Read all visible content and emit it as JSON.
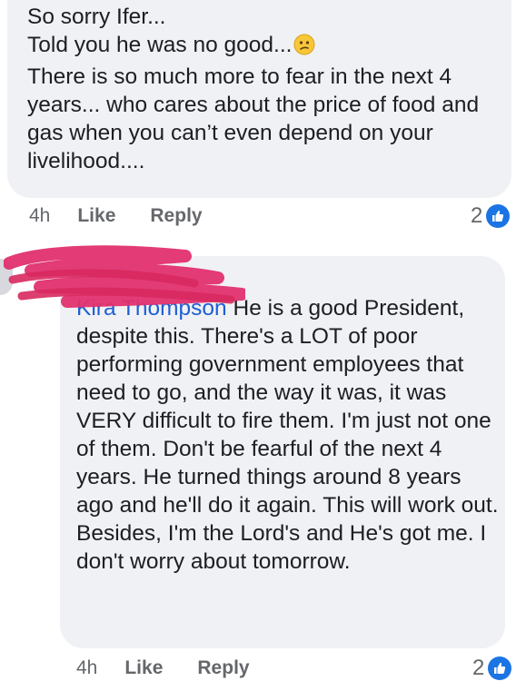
{
  "comment1": {
    "text_before_emoji": "So sorry Ifer...\nTold you he was no good...",
    "text_after_emoji": "\nThere is so much more to fear in the next 4 years... who cares about the price of food and gas when you can’t even depend on your livelihood....",
    "emoji": "confused-face-icon",
    "time": "4h",
    "like_label": "Like",
    "reply_label": "Reply",
    "reaction_count": "2"
  },
  "comment2": {
    "mention": "Kira Thompson",
    "text": " He is a good President, despite this. There's a LOT of poor performing government employees that need to go, and the way it was, it was VERY difficult to fire them. I'm just not one of them. Don't be fearful of the next 4 years. He turned things around 8 years ago and he'll do it again. This will work out. Besides, I'm the Lord's and He's got me. I don't worry about tomorrow.",
    "time": "4h",
    "like_label": "Like",
    "reply_label": "Reply",
    "reaction_count": "2"
  },
  "colors": {
    "bubble": "#f0f1f5",
    "mention": "#1d5fd3",
    "like_blue": "#1b74e4",
    "redaction": "#e0306f",
    "meta_text": "#65676b"
  }
}
